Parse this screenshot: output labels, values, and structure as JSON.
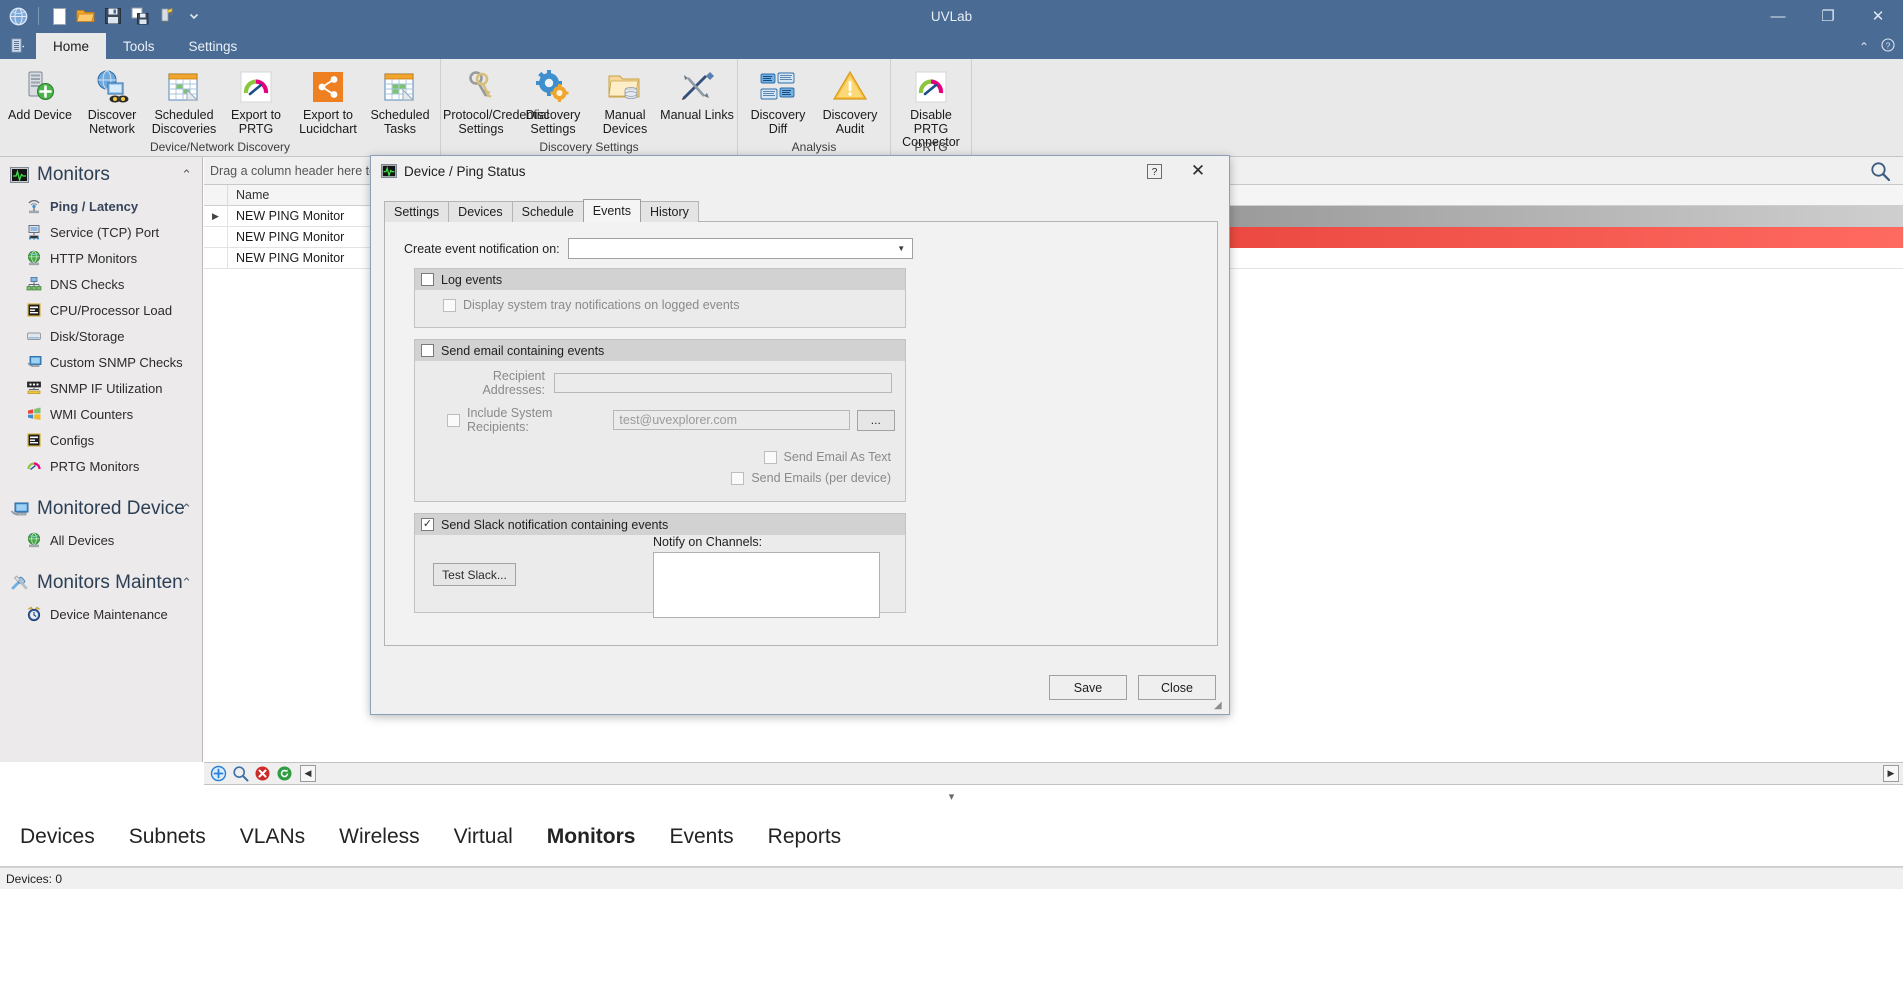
{
  "window": {
    "title": "UVLab",
    "minimize": "—",
    "maximize": "❐",
    "close": "✕"
  },
  "quick_access": [
    {
      "name": "app-globe-icon",
      "label": "UVLab"
    },
    {
      "name": "new-file-icon",
      "label": "New"
    },
    {
      "name": "open-folder-icon",
      "label": "Open"
    },
    {
      "name": "save-icon",
      "label": "Save"
    },
    {
      "name": "save-as-icon",
      "label": "Save As"
    },
    {
      "name": "add-device-quick-icon",
      "label": "Add Device"
    },
    {
      "name": "chevron-down-icon",
      "label": "Customize Quick Access Toolbar"
    }
  ],
  "ribbon": {
    "app_menu": "▤",
    "tabs": [
      {
        "label": "Home",
        "active": true
      },
      {
        "label": "Tools",
        "active": false
      },
      {
        "label": "Settings",
        "active": false
      }
    ],
    "collapse_icon": "⌃",
    "help_icon": "?",
    "groups": [
      {
        "label": "Device/Network Discovery",
        "buttons": [
          {
            "label": "Add Device",
            "icon": "add-device-icon"
          },
          {
            "label": "Discover Network",
            "icon": "discover-network-icon"
          },
          {
            "label": "Scheduled Discoveries",
            "icon": "scheduled-discoveries-icon"
          },
          {
            "label": "Export to PRTG",
            "icon": "export-prtg-icon"
          },
          {
            "label": "Export to Lucidchart",
            "icon": "export-lucidchart-icon"
          },
          {
            "label": "Scheduled Tasks",
            "icon": "scheduled-tasks-icon"
          }
        ]
      },
      {
        "label": "Discovery Settings",
        "buttons": [
          {
            "label": "Protocol/Credential Settings",
            "icon": "keys-icon"
          },
          {
            "label": "Discovery Settings",
            "icon": "gears-icon"
          },
          {
            "label": "Manual Devices",
            "icon": "manual-devices-icon"
          },
          {
            "label": "Manual Links",
            "icon": "manual-links-icon"
          }
        ]
      },
      {
        "label": "Analysis",
        "buttons": [
          {
            "label": "Discovery Diff",
            "icon": "discovery-diff-icon"
          },
          {
            "label": "Discovery Audit",
            "icon": "warning-triangle-icon"
          }
        ]
      },
      {
        "label": "PRTG",
        "buttons": [
          {
            "label": "Disable PRTG Connector",
            "icon": "prtg-gauge-icon"
          }
        ]
      }
    ]
  },
  "sidebar": {
    "sections": [
      {
        "title": "Monitors",
        "icon": "monitor-pulse-icon",
        "chevron": "⌃",
        "items": [
          {
            "label": "Ping / Latency",
            "icon": "ping-antenna-icon",
            "selected": true
          },
          {
            "label": "Service (TCP) Port",
            "icon": "tcp-port-icon",
            "selected": false
          },
          {
            "label": "HTTP Monitors",
            "icon": "globe-icon",
            "selected": false
          },
          {
            "label": "DNS Checks",
            "icon": "dns-tree-icon",
            "selected": false
          },
          {
            "label": "CPU/Processor Load",
            "icon": "cpu-chip-icon",
            "selected": false
          },
          {
            "label": "Disk/Storage",
            "icon": "disk-drive-icon",
            "selected": false
          },
          {
            "label": "Custom SNMP Checks",
            "icon": "snmp-monitor-icon",
            "selected": false
          },
          {
            "label": "SNMP IF Utilization",
            "icon": "snmp-if-icon",
            "selected": false
          },
          {
            "label": "WMI Counters",
            "icon": "windows-flag-icon",
            "selected": false
          },
          {
            "label": "Configs",
            "icon": "config-chip-icon",
            "selected": false
          },
          {
            "label": "PRTG Monitors",
            "icon": "prtg-gauge-icon",
            "selected": false
          }
        ]
      },
      {
        "title": "Monitored Device",
        "icon": "monitored-device-icon",
        "chevron": "⌃",
        "items": [
          {
            "label": "All Devices",
            "icon": "globe-icon",
            "selected": false
          }
        ]
      },
      {
        "title": "Monitors Mainten",
        "icon": "maintenance-tools-icon",
        "chevron": "⌃",
        "items": [
          {
            "label": "Device Maintenance",
            "icon": "alarm-clock-icon",
            "selected": false
          }
        ]
      }
    ]
  },
  "grid": {
    "drag_hint": "Drag a column header here to gr",
    "search_icon": "search-icon",
    "columns": [
      "Name"
    ],
    "rows": [
      {
        "indicator": "▶",
        "name": "NEW PING Monitor",
        "bar": "grey"
      },
      {
        "indicator": "",
        "name": "NEW PING Monitor",
        "bar": "red"
      },
      {
        "indicator": "",
        "name": "NEW PING Monitor",
        "bar": "none"
      }
    ],
    "footer_buttons": [
      {
        "name": "add-record-button",
        "glyph": "⊕",
        "color": "#2a7fd4"
      },
      {
        "name": "edit-record-button",
        "glyph": "⌕",
        "color": "#3c6fa8"
      },
      {
        "name": "delete-record-button",
        "glyph": "✖",
        "color": "#cc2b2b"
      },
      {
        "name": "refresh-record-button",
        "glyph": "⟳",
        "color": "#2f9c3f"
      }
    ],
    "nav_prev": "◀",
    "nav_next": "▶"
  },
  "bottom_nav": {
    "splitter_icon": "▾",
    "items": [
      {
        "label": "Devices",
        "active": false
      },
      {
        "label": "Subnets",
        "active": false
      },
      {
        "label": "VLANs",
        "active": false
      },
      {
        "label": "Wireless",
        "active": false
      },
      {
        "label": "Virtual",
        "active": false
      },
      {
        "label": "Monitors",
        "active": true
      },
      {
        "label": "Events",
        "active": false
      },
      {
        "label": "Reports",
        "active": false
      }
    ]
  },
  "status_bar": {
    "text": "Devices: 0"
  },
  "dialog": {
    "title": "Device / Ping Status",
    "title_icon": "monitor-pulse-icon",
    "help_button": "?",
    "close_button": "✕",
    "tabs": [
      {
        "label": "Settings",
        "active": false
      },
      {
        "label": "Devices",
        "active": false
      },
      {
        "label": "Schedule",
        "active": false
      },
      {
        "label": "Events",
        "active": true
      },
      {
        "label": "History",
        "active": false
      }
    ],
    "events": {
      "notification_label": "Create event notification on:",
      "notification_value": "",
      "notification_arrow": "▼",
      "log_events": {
        "label": "Log events",
        "checked": false,
        "sub_label": "Display system tray notifications on logged events",
        "sub_checked": false
      },
      "email": {
        "label": "Send email containing events",
        "checked": false,
        "recipient_label": "Recipient Addresses:",
        "recipient_value": "",
        "include_system_label": "Include System Recipients:",
        "include_system_checked": false,
        "system_recipients_value": "test@uvexplorer.com",
        "browse_button": "...",
        "send_as_text_label": "Send Email As Text",
        "send_as_text_checked": false,
        "send_per_device_label": "Send Emails (per device)",
        "send_per_device_checked": false
      },
      "slack": {
        "label": "Send Slack notification containing events",
        "checked": true,
        "test_button": "Test Slack...",
        "channels_label": "Notify on Channels:",
        "channels": []
      }
    },
    "footer": {
      "save": "Save",
      "close": "Close"
    },
    "resize_grip": "◢"
  },
  "colors": {
    "title_bar": "#4a6b94",
    "ribbon_bg": "#e9e9e9",
    "sidebar_bg": "#eceaea",
    "accent_blue": "#2a7fd4",
    "alert_red": "#cc2b2b",
    "ok_green": "#2f9c3f",
    "orange": "#e8821e"
  }
}
